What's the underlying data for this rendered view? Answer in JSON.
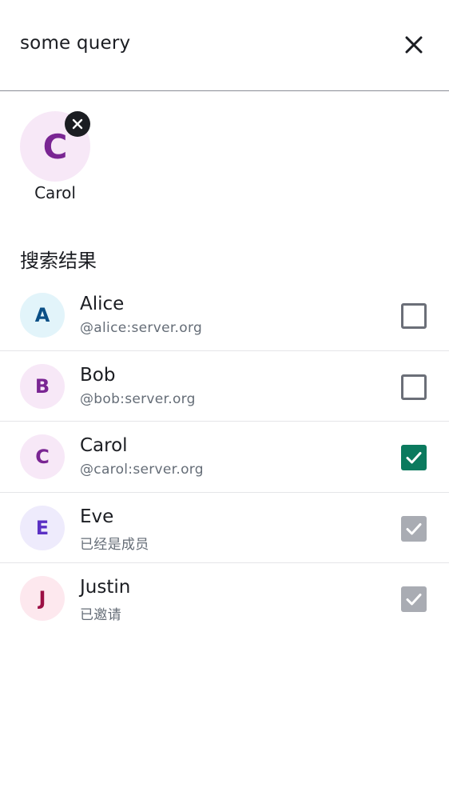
{
  "search": {
    "query": "some query"
  },
  "colors": {
    "accent": "#0b7a5e",
    "disabled": "#a9acb3",
    "text_secondary": "#656d77"
  },
  "selected": [
    {
      "initial": "C",
      "name": "Carol",
      "avatar_bg": "#f7e8f7",
      "avatar_fg": "#7a2593"
    }
  ],
  "results_title": "搜索结果",
  "results": [
    {
      "initial": "A",
      "name": "Alice",
      "sub": "@alice:server.org",
      "state": "unchecked",
      "avatar_bg": "#e2f4fa",
      "avatar_fg": "#0b4f86"
    },
    {
      "initial": "B",
      "name": "Bob",
      "sub": "@bob:server.org",
      "state": "unchecked",
      "avatar_bg": "#f7e8f7",
      "avatar_fg": "#7a2593"
    },
    {
      "initial": "C",
      "name": "Carol",
      "sub": "@carol:server.org",
      "state": "checked",
      "avatar_bg": "#f7e8f7",
      "avatar_fg": "#7a2593"
    },
    {
      "initial": "E",
      "name": "Eve",
      "sub": "已经是成员",
      "state": "disabled",
      "avatar_bg": "#eeebfc",
      "avatar_fg": "#5b30c4"
    },
    {
      "initial": "J",
      "name": "Justin",
      "sub": "已邀请",
      "state": "disabled",
      "avatar_bg": "#fde8ee",
      "avatar_fg": "#9c0f44"
    }
  ]
}
